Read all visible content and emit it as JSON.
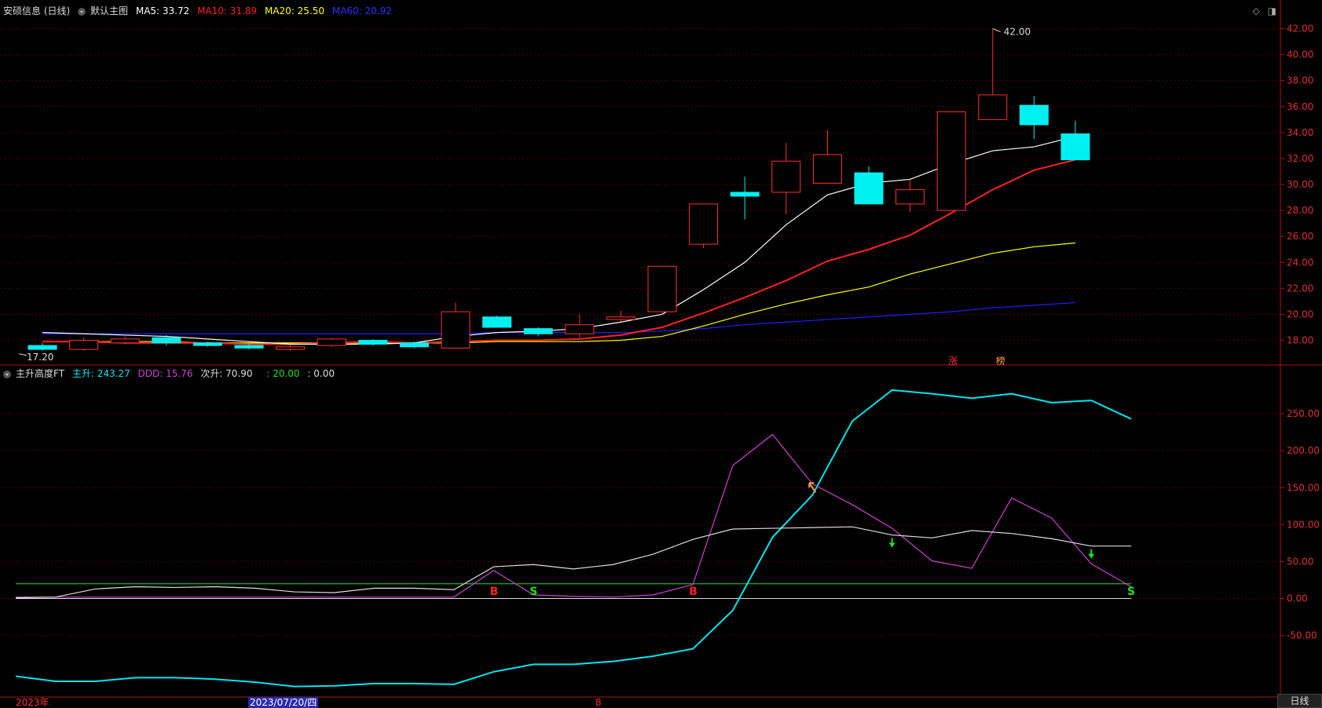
{
  "header": {
    "stock_name": "安硕信息 (日线)",
    "main_chart_label": "默认主图",
    "ma5": {
      "label": "MA5: 33.72",
      "color": "#ffffff"
    },
    "ma10": {
      "label": "MA10: 31.89",
      "color": "#ff2020"
    },
    "ma20": {
      "label": "MA20: 25.50",
      "color": "#ffff00"
    },
    "ma60": {
      "label": "MA60: 20.92",
      "color": "#2020ff"
    },
    "icons": [
      "diamond-icon",
      "window-icon"
    ]
  },
  "indicator_header": {
    "name": "主升高度FT",
    "zhusheng": {
      "label": "主升: 243.27",
      "color": "#00e5ee"
    },
    "ddd": {
      "label": "DDD: 15.76",
      "color": "#d040d0"
    },
    "cisheng": {
      "label": "次升: 70.90",
      "color": "#dddddd"
    },
    "line20": {
      "label": ": 20.00",
      "color": "#20e020"
    },
    "line0": {
      "label": ": 0.00",
      "color": "#dddddd"
    }
  },
  "footer": {
    "year_label": "2023年",
    "date_label": "2023/07/20/四",
    "month_label": "8",
    "tab_label": "日线"
  },
  "chart_data": [
    {
      "type": "candlestick",
      "yticks": [
        "42.00",
        "40.00",
        "38.00",
        "36.00",
        "34.00",
        "32.00",
        "30.00",
        "28.00",
        "26.00",
        "24.00",
        "22.00",
        "20.00",
        "18.00"
      ],
      "ylim": [
        16.4,
        43.0
      ],
      "candles": [
        {
          "o": 17.6,
          "c": 17.3,
          "h": 17.8,
          "l": 17.2
        },
        {
          "o": 17.3,
          "c": 18.0,
          "h": 18.2,
          "l": 17.2
        },
        {
          "o": 17.8,
          "c": 18.1,
          "h": 18.3,
          "l": 17.7
        },
        {
          "o": 18.2,
          "c": 17.8,
          "h": 18.4,
          "l": 17.6
        },
        {
          "o": 17.8,
          "c": 17.6,
          "h": 17.9,
          "l": 17.5
        },
        {
          "o": 17.6,
          "c": 17.4,
          "h": 17.8,
          "l": 17.3
        },
        {
          "o": 17.3,
          "c": 17.5,
          "h": 17.7,
          "l": 17.2
        },
        {
          "o": 17.6,
          "c": 18.1,
          "h": 18.2,
          "l": 17.5
        },
        {
          "o": 18.0,
          "c": 17.7,
          "h": 18.1,
          "l": 17.6
        },
        {
          "o": 17.8,
          "c": 17.5,
          "h": 17.9,
          "l": 17.4
        },
        {
          "o": 17.4,
          "c": 20.2,
          "h": 20.9,
          "l": 17.4
        },
        {
          "o": 19.8,
          "c": 19.0,
          "h": 19.9,
          "l": 19.0
        },
        {
          "o": 18.9,
          "c": 18.5,
          "h": 19.0,
          "l": 18.3
        },
        {
          "o": 18.5,
          "c": 19.2,
          "h": 20.0,
          "l": 18.2
        },
        {
          "o": 19.6,
          "c": 19.8,
          "h": 20.3,
          "l": 19.4
        },
        {
          "o": 20.2,
          "c": 23.7,
          "h": 23.7,
          "l": 20.1
        },
        {
          "o": 25.4,
          "c": 28.5,
          "h": 28.5,
          "l": 25.1
        },
        {
          "o": 29.4,
          "c": 29.1,
          "h": 30.6,
          "l": 27.3
        },
        {
          "o": 29.4,
          "c": 31.8,
          "h": 33.2,
          "l": 27.7
        },
        {
          "o": 30.1,
          "c": 32.3,
          "h": 34.2,
          "l": 30.1
        },
        {
          "o": 30.9,
          "c": 28.5,
          "h": 31.4,
          "l": 28.5
        },
        {
          "o": 28.5,
          "c": 29.6,
          "h": 30.4,
          "l": 27.9
        },
        {
          "o": 28.0,
          "c": 35.6,
          "h": 35.6,
          "l": 28.0
        },
        {
          "o": 35.0,
          "c": 36.9,
          "h": 42.0,
          "l": 35.0
        },
        {
          "o": 36.1,
          "c": 34.6,
          "h": 36.8,
          "l": 33.5
        },
        {
          "o": 33.9,
          "c": 31.9,
          "h": 34.9,
          "l": 31.9
        }
      ],
      "ma5": [
        18.6,
        18.5,
        18.4,
        18.3,
        18.1,
        17.9,
        17.7,
        17.7,
        17.7,
        17.8,
        18.3,
        18.6,
        18.7,
        18.9,
        19.4,
        20.0,
        21.9,
        24.0,
        26.9,
        29.2,
        30.1,
        30.4,
        31.6,
        32.6,
        32.9,
        33.7
      ],
      "ma10": [
        17.9,
        17.9,
        17.8,
        17.8,
        17.8,
        17.7,
        17.7,
        17.8,
        17.9,
        17.8,
        17.9,
        18.0,
        18.0,
        18.1,
        18.4,
        19.0,
        20.1,
        21.3,
        22.6,
        24.1,
        25.0,
        26.1,
        27.8,
        29.6,
        31.1,
        31.9
      ],
      "ma20": [
        17.9,
        17.9,
        17.9,
        17.9,
        17.8,
        17.8,
        17.8,
        17.8,
        17.8,
        17.8,
        17.8,
        17.9,
        17.9,
        17.9,
        18.0,
        18.3,
        19.1,
        20.0,
        20.8,
        21.5,
        22.1,
        23.1,
        23.9,
        24.7,
        25.2,
        25.5
      ],
      "ma60": [
        18.5,
        18.5,
        18.5,
        18.5,
        18.5,
        18.5,
        18.5,
        18.5,
        18.5,
        18.5,
        18.5,
        18.6,
        18.6,
        18.6,
        18.6,
        18.7,
        18.9,
        19.2,
        19.4,
        19.6,
        19.8,
        20.0,
        20.2,
        20.5,
        20.7,
        20.9
      ],
      "annotations": {
        "high": "42.00",
        "low": "17.20",
        "marker1": "涨",
        "marker2": "榜"
      }
    },
    {
      "type": "line",
      "yticks": [
        "250.00",
        "200.00",
        "150.00",
        "100.00",
        "50.00",
        "0.00",
        "-50.00"
      ],
      "ylim": [
        -130,
        300
      ],
      "series": [
        {
          "name": "主升",
          "color": "#00e5ee",
          "values": [
            -105,
            -112,
            -112,
            -107,
            -107,
            -109,
            -113,
            -119,
            -118,
            -115,
            -115,
            -116,
            -99,
            -89,
            -89,
            -85,
            -78,
            -68,
            -16,
            83,
            140,
            240,
            282,
            277,
            271,
            277,
            265,
            268,
            243
          ]
        },
        {
          "name": "DDD",
          "color": "#d040d0",
          "values": [
            2,
            2,
            2,
            2,
            2,
            2,
            2,
            2,
            2,
            2,
            2,
            2,
            38,
            5,
            3,
            2,
            5,
            19,
            180,
            222,
            155,
            127,
            95,
            51,
            41,
            136,
            109,
            47,
            16
          ]
        },
        {
          "name": "次升",
          "color": "#dddddd",
          "values": [
            1,
            2,
            13,
            16,
            15,
            16,
            14,
            9,
            8,
            14,
            14,
            12,
            43,
            46,
            40,
            46,
            60,
            80,
            94,
            95,
            96,
            97,
            86,
            82,
            92,
            88,
            81,
            71,
            71
          ]
        }
      ],
      "hlines": [
        {
          "value": 20,
          "color": "#20e020"
        },
        {
          "value": 0,
          "color": "#dddddd"
        }
      ],
      "signals": [
        {
          "idx": 12,
          "text": "B",
          "color": "#ff2020"
        },
        {
          "idx": 13,
          "text": "S",
          "color": "#20e020"
        },
        {
          "idx": 17,
          "text": "B",
          "color": "#ff2020"
        },
        {
          "idx": 28,
          "text": "S",
          "color": "#20e020"
        }
      ]
    }
  ]
}
